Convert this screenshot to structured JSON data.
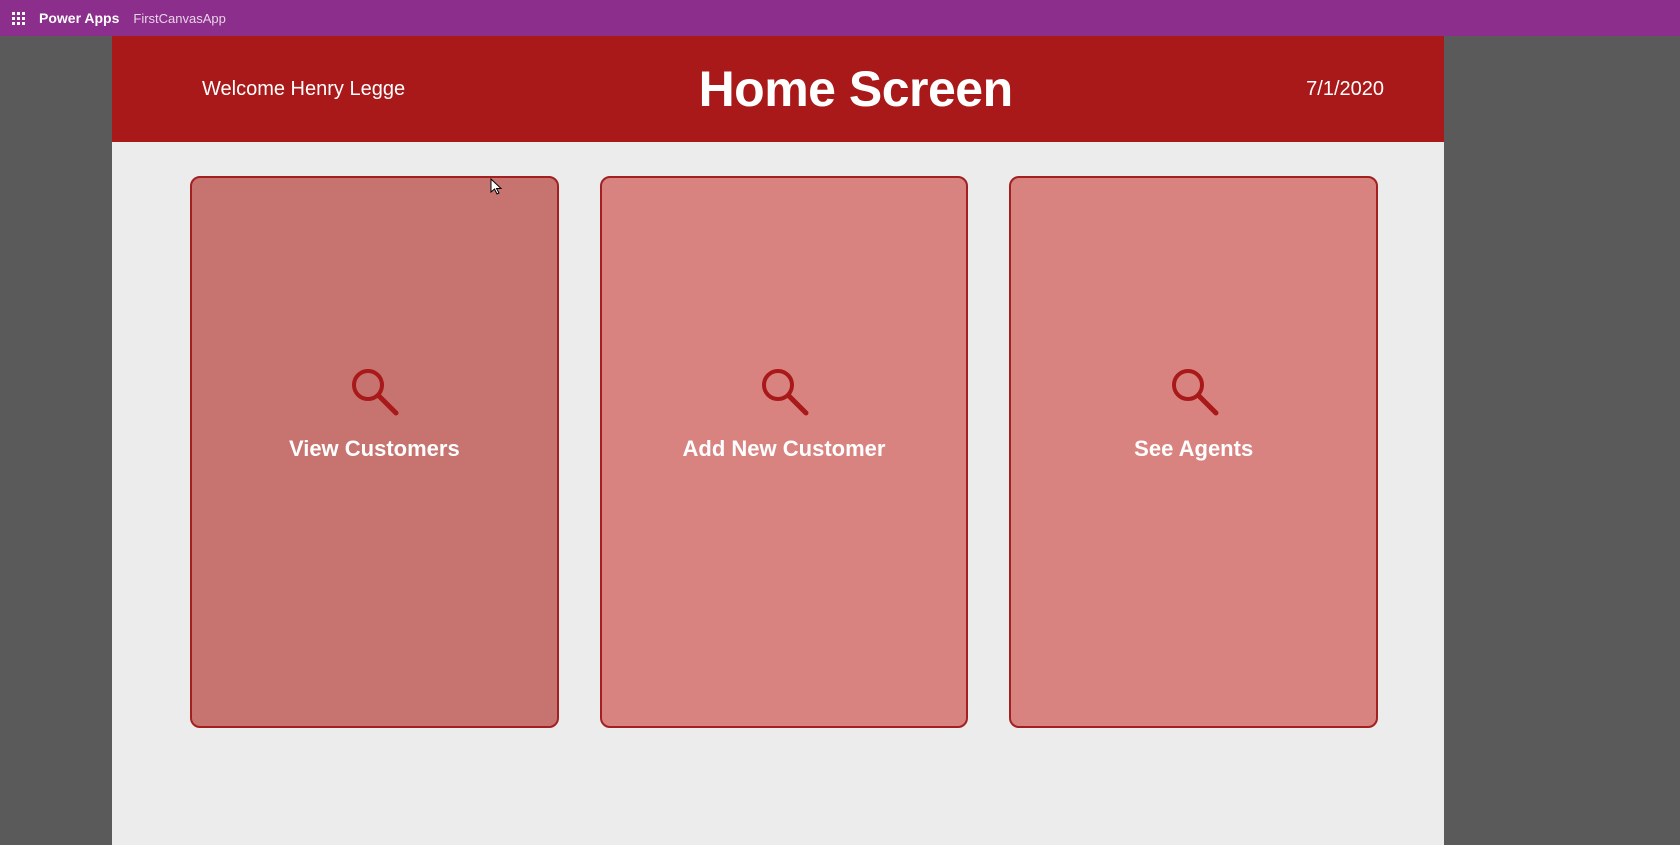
{
  "topbar": {
    "brand": "Power Apps",
    "app_name": "FirstCanvasApp"
  },
  "header": {
    "welcome": "Welcome Henry Legge",
    "title": "Home Screen",
    "date": "7/1/2020"
  },
  "tiles": [
    {
      "label": "View Customers",
      "icon": "search-icon",
      "hover": true
    },
    {
      "label": "Add New Customer",
      "icon": "search-icon",
      "hover": false
    },
    {
      "label": "See Agents",
      "icon": "search-icon",
      "hover": false
    }
  ],
  "colors": {
    "topbar": "#8c2e8c",
    "header": "#a91919",
    "tile": "#d98380",
    "tile_border": "#a22020",
    "tile_hover": "#c77370",
    "background": "#5a5a5a",
    "stage": "#ececec"
  }
}
